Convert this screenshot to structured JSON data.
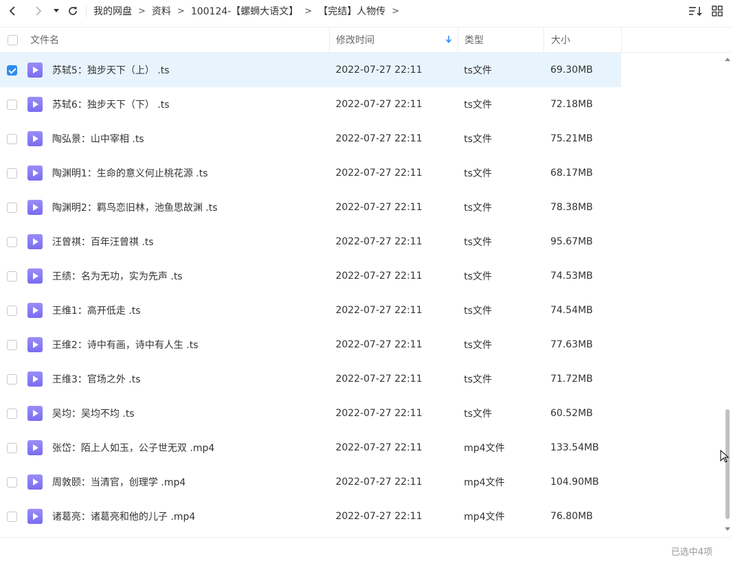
{
  "nav": {
    "back_icon": "chevron-left-icon",
    "forward_icon": "chevron-right-icon",
    "history_icon": "caret-down-icon",
    "refresh_icon": "refresh-icon",
    "breadcrumb": [
      "我的网盘",
      "资料",
      "100124-【螺蛳大语文】",
      "【完结】人物传"
    ],
    "separator": ">"
  },
  "view_controls": {
    "sort_icon": "sort-list-icon",
    "grid_icon": "grid-view-icon"
  },
  "columns": {
    "name": "文件名",
    "time": "修改时间",
    "type": "类型",
    "size": "大小",
    "sort_indicator": "arrow-down-icon"
  },
  "colors": {
    "accent": "#2d8cf0",
    "selected_row": "#e8f4fd",
    "file_icon": "#8b7ff3"
  },
  "files": [
    {
      "name": "苏轼5：独步天下（上） .ts",
      "time": "2022-07-27 22:11",
      "type": "ts文件",
      "size": "69.30MB",
      "selected": true
    },
    {
      "name": "苏轼6：独步天下（下） .ts",
      "time": "2022-07-27 22:11",
      "type": "ts文件",
      "size": "72.18MB",
      "selected": false
    },
    {
      "name": "陶弘景：山中宰相 .ts",
      "time": "2022-07-27 22:11",
      "type": "ts文件",
      "size": "75.21MB",
      "selected": false
    },
    {
      "name": "陶渊明1：生命的意义何止桃花源 .ts",
      "time": "2022-07-27 22:11",
      "type": "ts文件",
      "size": "68.17MB",
      "selected": false
    },
    {
      "name": "陶渊明2：羁鸟恋旧林，池鱼思故渊 .ts",
      "time": "2022-07-27 22:11",
      "type": "ts文件",
      "size": "78.38MB",
      "selected": false
    },
    {
      "name": "汪曾祺：百年汪曾祺 .ts",
      "time": "2022-07-27 22:11",
      "type": "ts文件",
      "size": "95.67MB",
      "selected": false
    },
    {
      "name": "王绩：名为无功，实为先声 .ts",
      "time": "2022-07-27 22:11",
      "type": "ts文件",
      "size": "74.53MB",
      "selected": false
    },
    {
      "name": "王维1：高开低走 .ts",
      "time": "2022-07-27 22:11",
      "type": "ts文件",
      "size": "74.54MB",
      "selected": false
    },
    {
      "name": "王维2：诗中有画，诗中有人生 .ts",
      "time": "2022-07-27 22:11",
      "type": "ts文件",
      "size": "77.63MB",
      "selected": false
    },
    {
      "name": "王维3：官场之外 .ts",
      "time": "2022-07-27 22:11",
      "type": "ts文件",
      "size": "71.72MB",
      "selected": false
    },
    {
      "name": "吴均：吴均不均 .ts",
      "time": "2022-07-27 22:11",
      "type": "ts文件",
      "size": "60.52MB",
      "selected": false
    },
    {
      "name": "张岱：陌上人如玉，公子世无双 .mp4",
      "time": "2022-07-27 22:11",
      "type": "mp4文件",
      "size": "133.54MB",
      "selected": false
    },
    {
      "name": "周敦颐：当清官，创理学 .mp4",
      "time": "2022-07-27 22:11",
      "type": "mp4文件",
      "size": "104.90MB",
      "selected": false
    },
    {
      "name": "诸葛亮：诸葛亮和他的儿子 .mp4",
      "time": "2022-07-27 22:11",
      "type": "mp4文件",
      "size": "76.80MB",
      "selected": false
    }
  ],
  "status": {
    "selected_count": "已选中4项"
  }
}
